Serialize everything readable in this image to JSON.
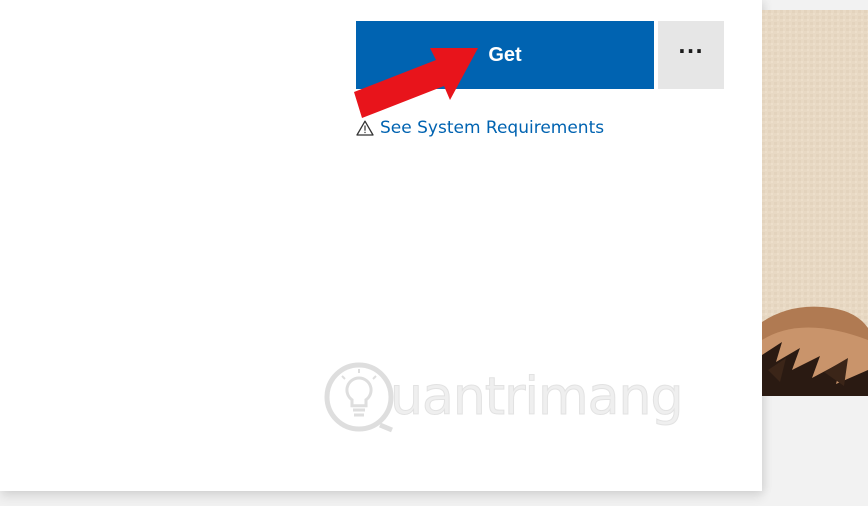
{
  "actions": {
    "get_label": "Get",
    "more_label": "···"
  },
  "system_requirements": {
    "label": "See System Requirements",
    "icon": "warning-icon"
  },
  "watermark": {
    "text": "uantrimang"
  },
  "colors": {
    "accent": "#0063b1",
    "secondary_button": "#e6e6e6",
    "annotation": "#e8141b"
  }
}
